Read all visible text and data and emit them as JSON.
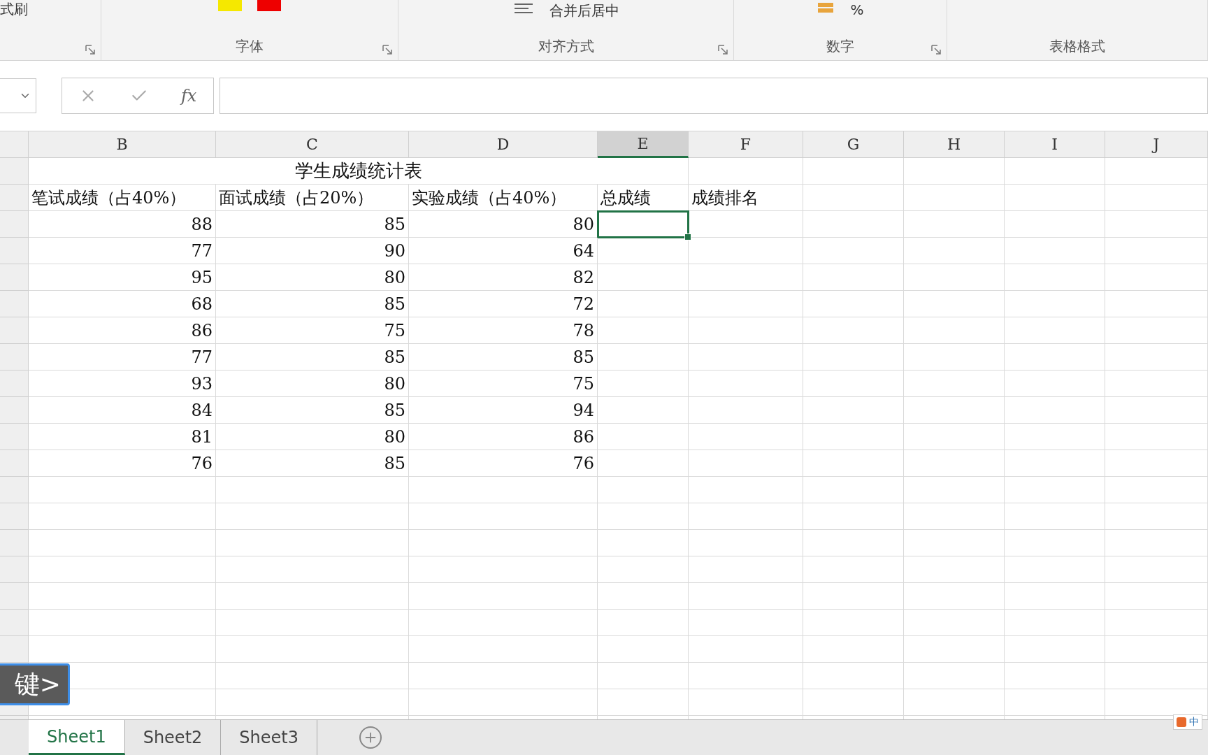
{
  "ribbon": {
    "clipboard_fragment": "式刷",
    "groups": [
      {
        "label": "字体",
        "launcher": true
      },
      {
        "label": "对齐方式",
        "launcher": true
      },
      {
        "label": "数字",
        "launcher": true
      },
      {
        "label": "表格格式",
        "launcher": false
      }
    ],
    "merge_button": "合并后居中",
    "percent": "%"
  },
  "formula_bar": {
    "fx": "fx"
  },
  "columns": [
    {
      "label": "B",
      "selected": false
    },
    {
      "label": "C",
      "selected": false
    },
    {
      "label": "D",
      "selected": false
    },
    {
      "label": "E",
      "selected": true
    },
    {
      "label": "F",
      "selected": false
    },
    {
      "label": "G",
      "selected": false
    },
    {
      "label": "H",
      "selected": false
    },
    {
      "label": "I",
      "selected": false
    },
    {
      "label": "J",
      "selected": false
    }
  ],
  "title": "学生成绩统计表",
  "headers": [
    "笔试成绩（占40%）",
    "面试成绩（占20%）",
    "实验成绩（占40%）",
    "总成绩",
    "成绩排名"
  ],
  "rows": [
    {
      "written": "88",
      "interview": "85",
      "experiment": "80",
      "selected": true
    },
    {
      "written": "77",
      "interview": "90",
      "experiment": "64",
      "selected": false
    },
    {
      "written": "95",
      "interview": "80",
      "experiment": "82",
      "selected": false
    },
    {
      "written": "68",
      "interview": "85",
      "experiment": "72",
      "selected": false
    },
    {
      "written": "86",
      "interview": "75",
      "experiment": "78",
      "selected": false
    },
    {
      "written": "77",
      "interview": "85",
      "experiment": "85",
      "selected": false
    },
    {
      "written": "93",
      "interview": "80",
      "experiment": "75",
      "selected": false
    },
    {
      "written": "84",
      "interview": "85",
      "experiment": "94",
      "selected": false
    },
    {
      "written": "81",
      "interview": "80",
      "experiment": "86",
      "selected": false
    },
    {
      "written": "76",
      "interview": "85",
      "experiment": "76",
      "selected": false
    }
  ],
  "key_hint": "键>",
  "sheets": [
    {
      "label": "Sheet1",
      "selected": true
    },
    {
      "label": "Sheet2",
      "selected": false
    },
    {
      "label": "Sheet3",
      "selected": false
    }
  ],
  "ime": "中"
}
